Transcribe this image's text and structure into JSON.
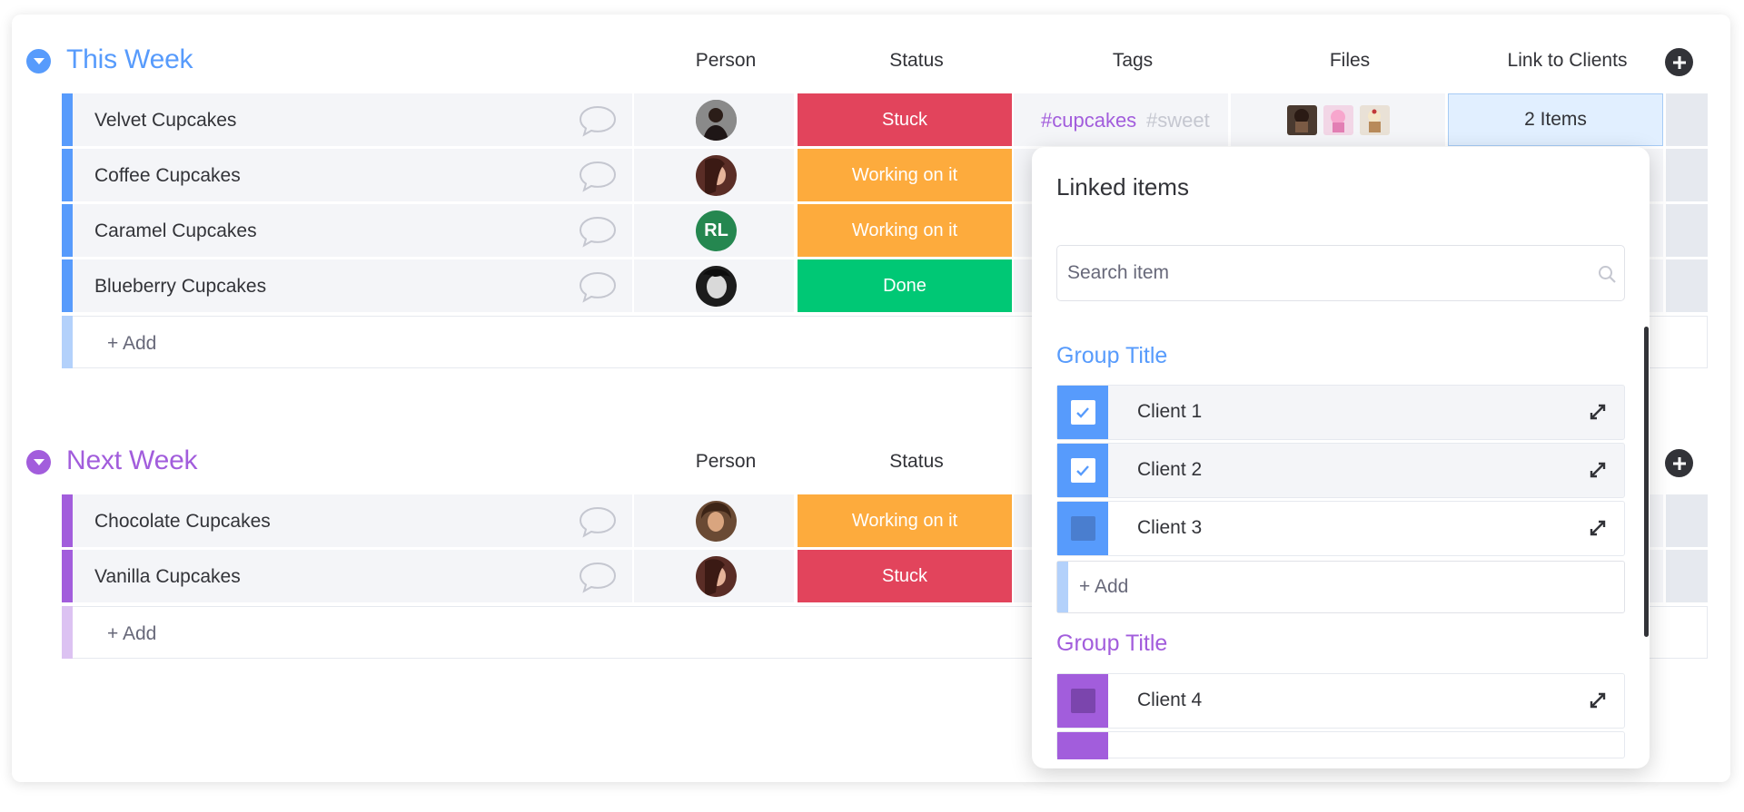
{
  "colors": {
    "group_this_week": "#579bfc",
    "group_next_week": "#a25ddc",
    "status_stuck": "#e2445c",
    "status_working": "#fdab3d",
    "status_done": "#00c875",
    "tag_primary": "#a25ddc",
    "tag_secondary": "#c5c7d0"
  },
  "groups": [
    {
      "name": "This Week",
      "columns": [
        "Person",
        "Status",
        "Tags",
        "Files",
        "Link to Clients"
      ],
      "rows": [
        {
          "name": "Velvet Cupcakes",
          "person_initials": "",
          "status": "Stuck",
          "tags": [
            "#cupcakes",
            "#sweet"
          ],
          "file_icons": [
            "cupcake-photo-1",
            "cupcake-photo-2",
            "cupcake-photo-3"
          ],
          "link": "2 Items"
        },
        {
          "name": "Coffee Cupcakes",
          "person_initials": "",
          "status": "Working on it"
        },
        {
          "name": "Caramel Cupcakes",
          "person_initials": "RL",
          "status": "Working on it"
        },
        {
          "name": "Blueberry Cupcakes",
          "person_initials": "",
          "status": "Done"
        }
      ],
      "add_label": "+ Add"
    },
    {
      "name": "Next Week",
      "columns": [
        "Person",
        "Status"
      ],
      "rows": [
        {
          "name": "Chocolate Cupcakes",
          "person_initials": "",
          "status": "Working on it"
        },
        {
          "name": "Vanilla Cupcakes",
          "person_initials": "",
          "status": "Stuck"
        }
      ],
      "add_label": "+ Add"
    }
  ],
  "popup": {
    "title": "Linked items",
    "search_placeholder": "Search item",
    "groups": [
      {
        "title": "Group Title",
        "clients": [
          {
            "name": "Client 1",
            "checked": true
          },
          {
            "name": "Client 2",
            "checked": true
          },
          {
            "name": "Client 3",
            "checked": false
          }
        ],
        "add_label": "+ Add"
      },
      {
        "title": "Group Title",
        "clients": [
          {
            "name": "Client 4",
            "checked": false
          }
        ]
      }
    ]
  }
}
